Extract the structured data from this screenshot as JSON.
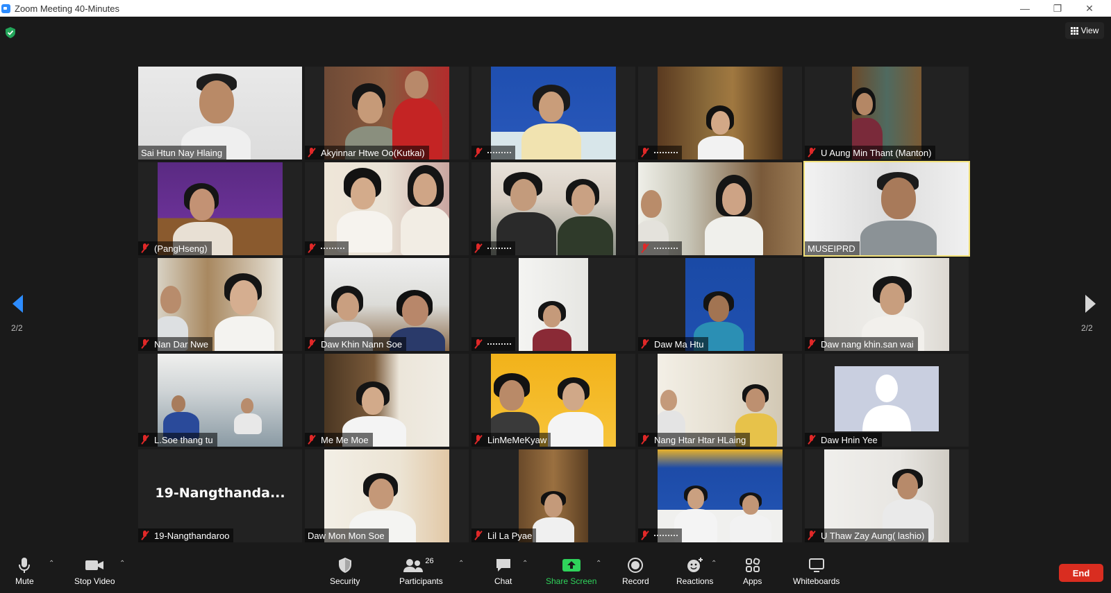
{
  "window": {
    "title": "Zoom Meeting 40-Minutes",
    "minimize": "—",
    "maximize": "❐",
    "close": "✕"
  },
  "header": {
    "view_label": "View"
  },
  "pagination": {
    "left": "2/2",
    "right": "2/2"
  },
  "participants": [
    {
      "name": "Sai Htun Nay Hlaing",
      "muted": false
    },
    {
      "name": "Akyinnar Htwe Oo(Kutkai)",
      "muted": true
    },
    {
      "name": "",
      "muted": true
    },
    {
      "name": "",
      "muted": true
    },
    {
      "name": "U Aung Min Thant (Manton)",
      "muted": true
    },
    {
      "name": "(PangHseng)",
      "muted": true
    },
    {
      "name": "",
      "muted": true
    },
    {
      "name": "",
      "muted": true
    },
    {
      "name": "",
      "muted": true
    },
    {
      "name": "MUSEIPRD",
      "muted": false,
      "active_speaker": true
    },
    {
      "name": "Nan Dar Nwe",
      "muted": true
    },
    {
      "name": "Daw Khin Nann Soe",
      "muted": true
    },
    {
      "name": "",
      "muted": true
    },
    {
      "name": "Daw Ma Htu",
      "muted": true
    },
    {
      "name": "Daw nang khin.san wai",
      "muted": true
    },
    {
      "name": "L.Soe thang tu",
      "muted": true
    },
    {
      "name": "Me Me Moe",
      "muted": true
    },
    {
      "name": "LinMeMeKyaw",
      "muted": true
    },
    {
      "name": "Nang Htar Htar HLaing",
      "muted": true
    },
    {
      "name": "Daw Hnin Yee",
      "muted": true
    },
    {
      "name": "19-Nangthandaroo",
      "muted": true,
      "video_off_label": "19-Nangthanda..."
    },
    {
      "name": "Daw Mon Mon Soe",
      "muted": false
    },
    {
      "name": "Lil La Pyae",
      "muted": true
    },
    {
      "name": "",
      "muted": true
    },
    {
      "name": "U Thaw Zay Aung( lashio)",
      "muted": true
    }
  ],
  "toolbar": {
    "mute": "Mute",
    "stop_video": "Stop Video",
    "security": "Security",
    "participants": "Participants",
    "participants_count": "26",
    "chat": "Chat",
    "share_screen": "Share Screen",
    "record": "Record",
    "reactions": "Reactions",
    "apps": "Apps",
    "whiteboards": "Whiteboards",
    "end": "End"
  },
  "colors": {
    "accent_share": "#2fd35b",
    "end_button": "#d92d20",
    "active_speaker_border": "#f3e27a",
    "muted_icon": "#e02828"
  }
}
